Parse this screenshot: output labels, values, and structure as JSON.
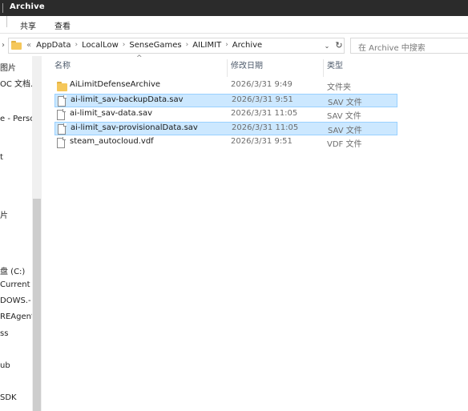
{
  "window": {
    "title": "Archive"
  },
  "ribbon": {
    "tabs": [
      "共享",
      "查看"
    ]
  },
  "address": {
    "lead": "«",
    "crumbs": [
      "AppData",
      "LocalLow",
      "SenseGames",
      "AILIMIT",
      "Archive"
    ],
    "separator": "›",
    "refresh_glyph": "↻",
    "dropdown_glyph": "⌄",
    "search_placeholder": "在 Archive 中搜索"
  },
  "navpane": {
    "items": [
      "图片",
      "OC 文档.",
      "e - Perso",
      "t",
      "片",
      "盘 (C:)",
      "Current",
      "DOWS.-",
      "REAgent",
      "ss",
      "ub",
      "SDK"
    ]
  },
  "columns": {
    "name": "名称",
    "date": "修改日期",
    "type": "类型",
    "sort_arrow": "^"
  },
  "files": [
    {
      "name": "AiLimitDefenseArchive",
      "date": "2026/3/31 9:49",
      "type": "文件夹",
      "icon": "folder-icon",
      "selected": false
    },
    {
      "name": "ai-limit_sav-backupData.sav",
      "date": "2026/3/31 9:51",
      "type": "SAV 文件",
      "icon": "file-icon",
      "selected": true
    },
    {
      "name": "ai-limit_sav-data.sav",
      "date": "2026/3/31 11:05",
      "type": "SAV 文件",
      "icon": "file-icon",
      "selected": false
    },
    {
      "name": "ai-limit_sav-provisionalData.sav",
      "date": "2026/3/31 11:05",
      "type": "SAV 文件",
      "icon": "file-icon",
      "selected": true
    },
    {
      "name": "steam_autocloud.vdf",
      "date": "2026/3/31 9:51",
      "type": "VDF 文件",
      "icon": "file-icon",
      "selected": false
    }
  ]
}
